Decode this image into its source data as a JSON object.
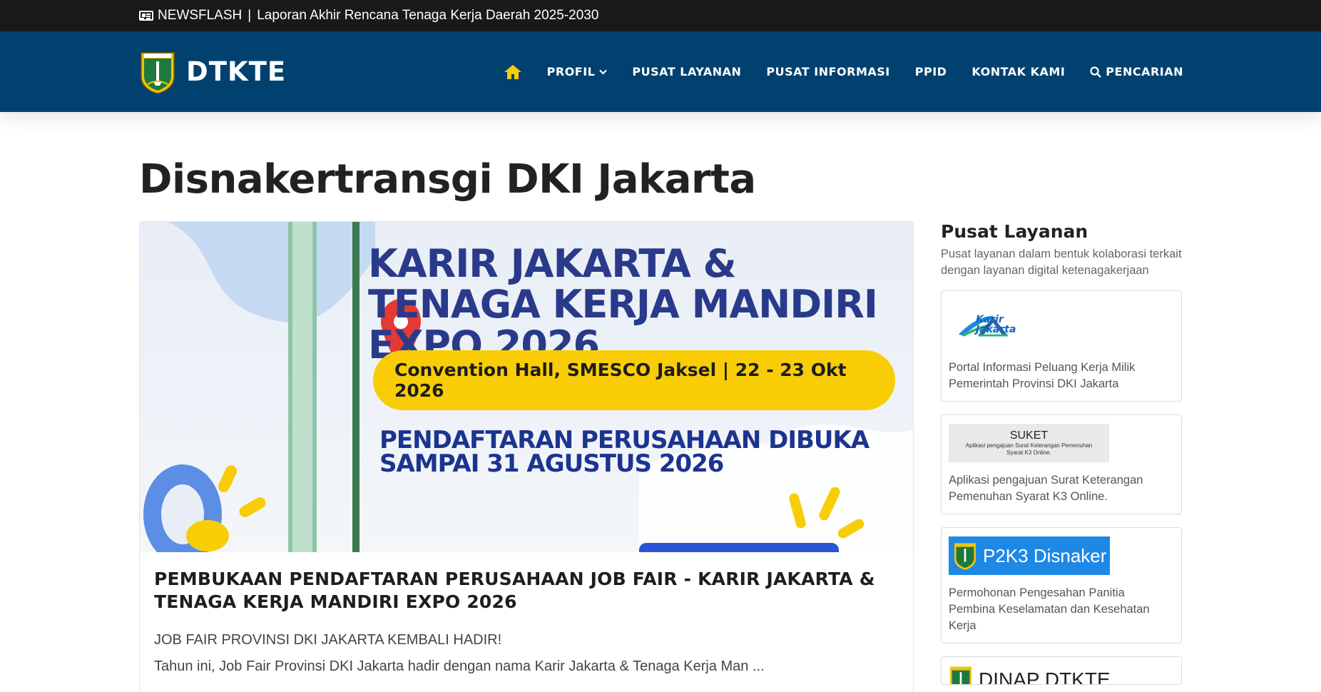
{
  "newsflash": {
    "label": "NEWSFLASH",
    "separator": "|",
    "headline": "Laporan Akhir Rencana Tenaga Kerja Daerah 2025-2030"
  },
  "header": {
    "brand": "DTKTE",
    "nav": {
      "profil": "PROFIL",
      "pusat_layanan": "PUSAT LAYANAN",
      "pusat_informasi": "PUSAT INFORMASI",
      "ppid": "PPID",
      "kontak": "KONTAK KAMI",
      "pencarian": "PENCARIAN"
    },
    "colors": {
      "bar": "#004170",
      "home_icon": "#f8cd06"
    }
  },
  "page": {
    "title": "Disnakertransgi DKI Jakarta"
  },
  "featured": {
    "banner": {
      "headline": "KARIR JAKARTA & TENAGA KERJA MANDIRI EXPO 2026",
      "venue": "Convention Hall, SMESCO Jaksel | 22 - 23 Okt 2026",
      "registration": "PENDAFTARAN PERUSAHAAN DIBUKA SAMPAI 31 AGUSTUS 2026"
    },
    "title": "PEMBUKAAN PENDAFTARAN PERUSAHAAN JOB FAIR - KARIR JAKARTA & TENAGA KERJA MANDIRI EXPO 2026",
    "lead": "JOB FAIR PROVINSI DKI JAKARTA KEMBALI HADIR!",
    "excerpt": "Tahun ini, Job Fair Provinsi DKI Jakarta hadir dengan nama Karir Jakarta & Tenaga Kerja Man ..."
  },
  "sidebar": {
    "title": "Pusat Layanan",
    "description": "Pusat layanan dalam bentuk kolaborasi terkait dengan layanan digital ketenagakerjaan",
    "services": [
      {
        "logo_text": "Karir Jakarta",
        "description": "Portal Informasi Peluang Kerja Milik Pemerintah Provinsi DKI Jakarta"
      },
      {
        "logo_title": "SUKET",
        "logo_subtitle": "Aplikasi pengajuan Surat Keterangan Pemenuhan Syarat K3 Online.",
        "description": "Aplikasi pengajuan Surat Keterangan Pemenuhan Syarat K3 Online."
      },
      {
        "logo_text": "P2K3 Disnaker",
        "description": "Permohonan Pengesahan Panitia Pembina Keselamatan dan Kesehatan Kerja"
      },
      {
        "logo_text": "DINAP DTKTE"
      }
    ]
  }
}
